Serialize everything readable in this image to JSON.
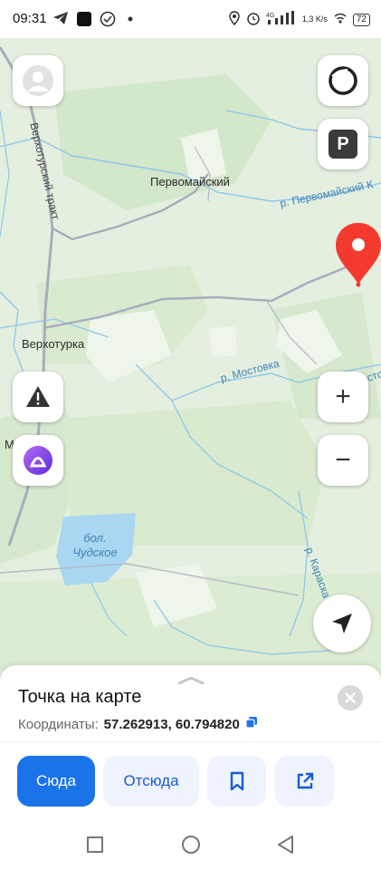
{
  "status_bar": {
    "time": "09:31",
    "network_speed": "1,3 K/s",
    "battery": "72",
    "icons": [
      "telegram-icon",
      "app-icon",
      "check-icon",
      "dot-icon",
      "location-icon",
      "alarm-icon",
      "signal-icon",
      "wifi-icon"
    ]
  },
  "map": {
    "places": {
      "pervomaisky": "Первомайский",
      "verkhoturka": "Верхотурка",
      "partial_left": "Мо"
    },
    "rivers": {
      "pervomaisky_river": "р. Первомайский К",
      "mostovka": "р. Мостовка",
      "mostovka_right": "р. Мосто",
      "karaska": "р. Караска"
    },
    "road": "Верхотурский тракт",
    "lake": {
      "prefix": "бол.",
      "name": "Чудское"
    },
    "colors": {
      "land": "#e4efdf",
      "forest": "#d5e8cc",
      "water": "#8ec7ea",
      "road": "#a6adbb",
      "pin": "#f43a2e"
    }
  },
  "controls": {
    "profile": "profile-icon",
    "alice": "alice-icon",
    "parking": "P",
    "warning": "warning-icon",
    "voice": "voice-assistant-icon",
    "zoom_in": "+",
    "zoom_out": "−",
    "locate": "locate-icon"
  },
  "place_card": {
    "title": "Точка на карте",
    "coords_label": "Координаты:",
    "coords_value": "57.262913, 60.794820",
    "buttons": {
      "to_here": "Сюда",
      "from_here": "Отсюда"
    }
  }
}
